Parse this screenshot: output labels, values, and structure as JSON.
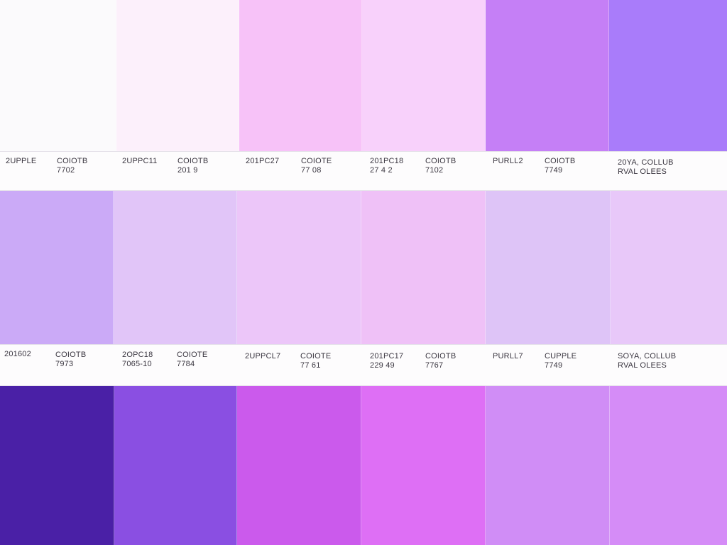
{
  "swatch_rows": [
    {
      "colors": [
        "#fbfafc",
        "#fcf0fb",
        "#f7c2f8",
        "#f8d1fb",
        "#c57ff6",
        "#a97cfa"
      ]
    },
    {
      "colors": [
        "#cbaaf7",
        "#e1c5f8",
        "#ecc6f9",
        "#efc1f7",
        "#dec4f7",
        "#e8c8f9"
      ]
    },
    {
      "colors": [
        "#4a20a6",
        "#8a4fe2",
        "#cb5aec",
        "#de6ff5",
        "#d08df6",
        "#d58cf7"
      ]
    }
  ],
  "label_strips": [
    {
      "labels": [
        {
          "lines": [
            "2UPPLE"
          ]
        },
        {
          "lines": [
            "COIOTB",
            "7702"
          ]
        },
        {
          "lines": [
            "2UPPC11"
          ]
        },
        {
          "lines": [
            "COIOTB",
            "201 9"
          ]
        },
        {
          "lines": [
            "201PC27"
          ]
        },
        {
          "lines": [
            "COIOTE",
            "77 08"
          ]
        },
        {
          "lines": [
            "201PC18",
            "27 4 2"
          ]
        },
        {
          "lines": [
            "COIOTB",
            "7102"
          ]
        },
        {
          "lines": [
            "PURLL2"
          ]
        },
        {
          "lines": [
            "COIOTB",
            "7749"
          ]
        },
        {
          "lines": [
            "20YA, COLLUB",
            "RVAL OLEES"
          ]
        }
      ]
    },
    {
      "labels": [
        {
          "lines": [
            "201602"
          ]
        },
        {
          "lines": [
            "COIOTB",
            "7973"
          ]
        },
        {
          "lines": [
            "2OPC18",
            "7065-10"
          ]
        },
        {
          "lines": [
            "COIOTE",
            "7784"
          ]
        },
        {
          "lines": [
            "2UPPCL7"
          ]
        },
        {
          "lines": [
            "COIOTE",
            "77 61"
          ]
        },
        {
          "lines": [
            "201PC17",
            "229 49"
          ]
        },
        {
          "lines": [
            "COIOTB",
            "7767"
          ]
        },
        {
          "lines": [
            "PURLL7"
          ]
        },
        {
          "lines": [
            "CUPPLE",
            "7749"
          ]
        },
        {
          "lines": [
            "SOYA, COLLUB",
            "RVAL OLEES"
          ]
        }
      ]
    }
  ]
}
